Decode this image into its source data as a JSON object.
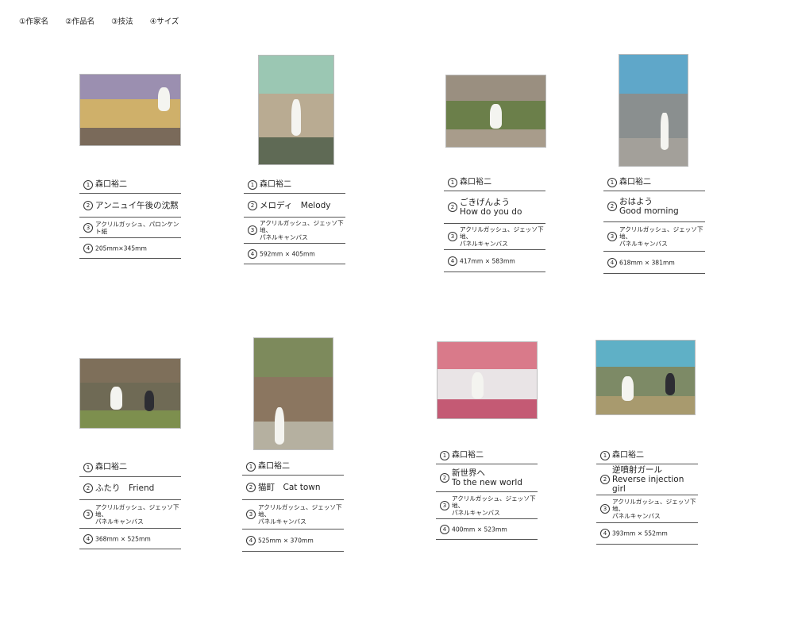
{
  "legend": [
    "①作家名",
    "②作品名",
    "③技法",
    "④サイズ"
  ],
  "works": [
    {
      "artist": "森口裕二",
      "title": "アンニュイ午後の沈黙",
      "technique": "アクリルガッシュ、パロンケント紙",
      "size": "205mm×345mm",
      "colors": {
        "sky": "#9b8fb0",
        "mid": "#cfb06a",
        "low": "#7a6a5a"
      }
    },
    {
      "artist": "森口裕二",
      "title": "メロディ　Melody",
      "technique": "アクリルガッシュ、ジェッソ下地、\nパネルキャンバス",
      "size": "592mm × 405mm",
      "colors": {
        "sky": "#9bc7b3",
        "mid": "#b9ab92",
        "low": "#5f6a55"
      }
    },
    {
      "artist": "森口裕二",
      "title": "ごきげんよう\nHow do you do",
      "technique": "アクリルガッシュ、ジェッソ下地、\nパネルキャンバス",
      "size": "417mm × 583mm",
      "colors": {
        "sky": "#9a8f80",
        "mid": "#6b7f4a",
        "low": "#a89c8b"
      }
    },
    {
      "artist": "森口裕二",
      "title": "おはよう\nGood morning",
      "technique": "アクリルガッシュ、ジェッソ下地、\nパネルキャンバス",
      "size": "618mm × 381mm",
      "colors": {
        "sky": "#5fa7c9",
        "mid": "#8a8f8f",
        "low": "#a3a09a"
      }
    },
    {
      "artist": "森口裕二",
      "title": "ふたり　Friend",
      "technique": "アクリルガッシュ、ジェッソ下地、\nパネルキャンバス",
      "size": "368mm × 525mm",
      "colors": {
        "sky": "#7e6f5a",
        "mid": "#6f6a55",
        "low": "#7d8f4e"
      }
    },
    {
      "artist": "森口裕二",
      "title": "猫町　Cat town",
      "technique": "アクリルガッシュ、ジェッソ下地、\nパネルキャンバス",
      "size": "525mm × 370mm",
      "colors": {
        "sky": "#7d8a5c",
        "mid": "#8b7660",
        "low": "#b5b0a0"
      }
    },
    {
      "artist": "森口裕二",
      "title": "新世界へ\nTo the new world",
      "technique": "アクリルガッシュ、ジェッソ下地、\nパネルキャンバス",
      "size": "400mm × 523mm",
      "colors": {
        "sky": "#d97a8a",
        "mid": "#e9e4e6",
        "low": "#c45a74"
      }
    },
    {
      "artist": "森口裕二",
      "title": "逆噴射ガール\nReverse injection girl",
      "technique": "アクリルガッシュ、ジェッソ下地、\nパネルキャンバス",
      "size": "393mm × 552mm",
      "colors": {
        "sky": "#5fb0c6",
        "mid": "#7d8a66",
        "low": "#a89a6e"
      }
    }
  ]
}
